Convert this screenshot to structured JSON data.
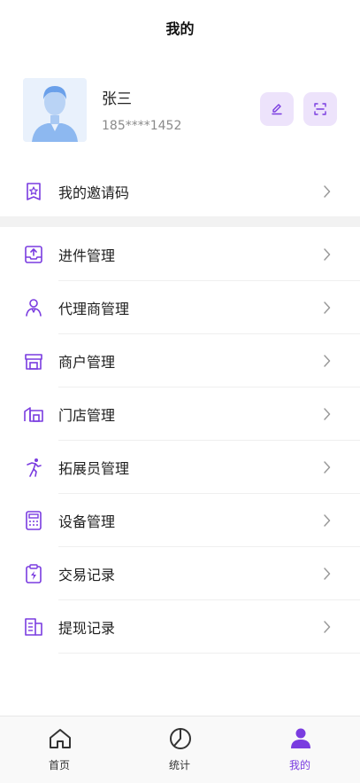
{
  "header": {
    "title": "我的"
  },
  "profile": {
    "name": "张三",
    "phone": "185****1452"
  },
  "colors": {
    "accent": "#7a3ce0",
    "accent_soft": "#ede3fb",
    "avatar_bg": "#e9f1fc"
  },
  "menu": {
    "invite": {
      "label": "我的邀请码",
      "icon": "star-badge-icon"
    },
    "items": [
      {
        "label": "进件管理",
        "icon": "upload-tray-icon"
      },
      {
        "label": "代理商管理",
        "icon": "person-icon"
      },
      {
        "label": "商户管理",
        "icon": "store-icon"
      },
      {
        "label": "门店管理",
        "icon": "building-icon"
      },
      {
        "label": "拓展员管理",
        "icon": "runner-icon"
      },
      {
        "label": "设备管理",
        "icon": "calculator-icon"
      },
      {
        "label": "交易记录",
        "icon": "clipboard-bolt-icon"
      },
      {
        "label": "提现记录",
        "icon": "receipt-icon"
      }
    ]
  },
  "tabs": [
    {
      "label": "首页",
      "icon": "home-icon",
      "active": false
    },
    {
      "label": "统计",
      "icon": "pie-chart-icon",
      "active": false
    },
    {
      "label": "我的",
      "icon": "user-icon",
      "active": true
    }
  ]
}
